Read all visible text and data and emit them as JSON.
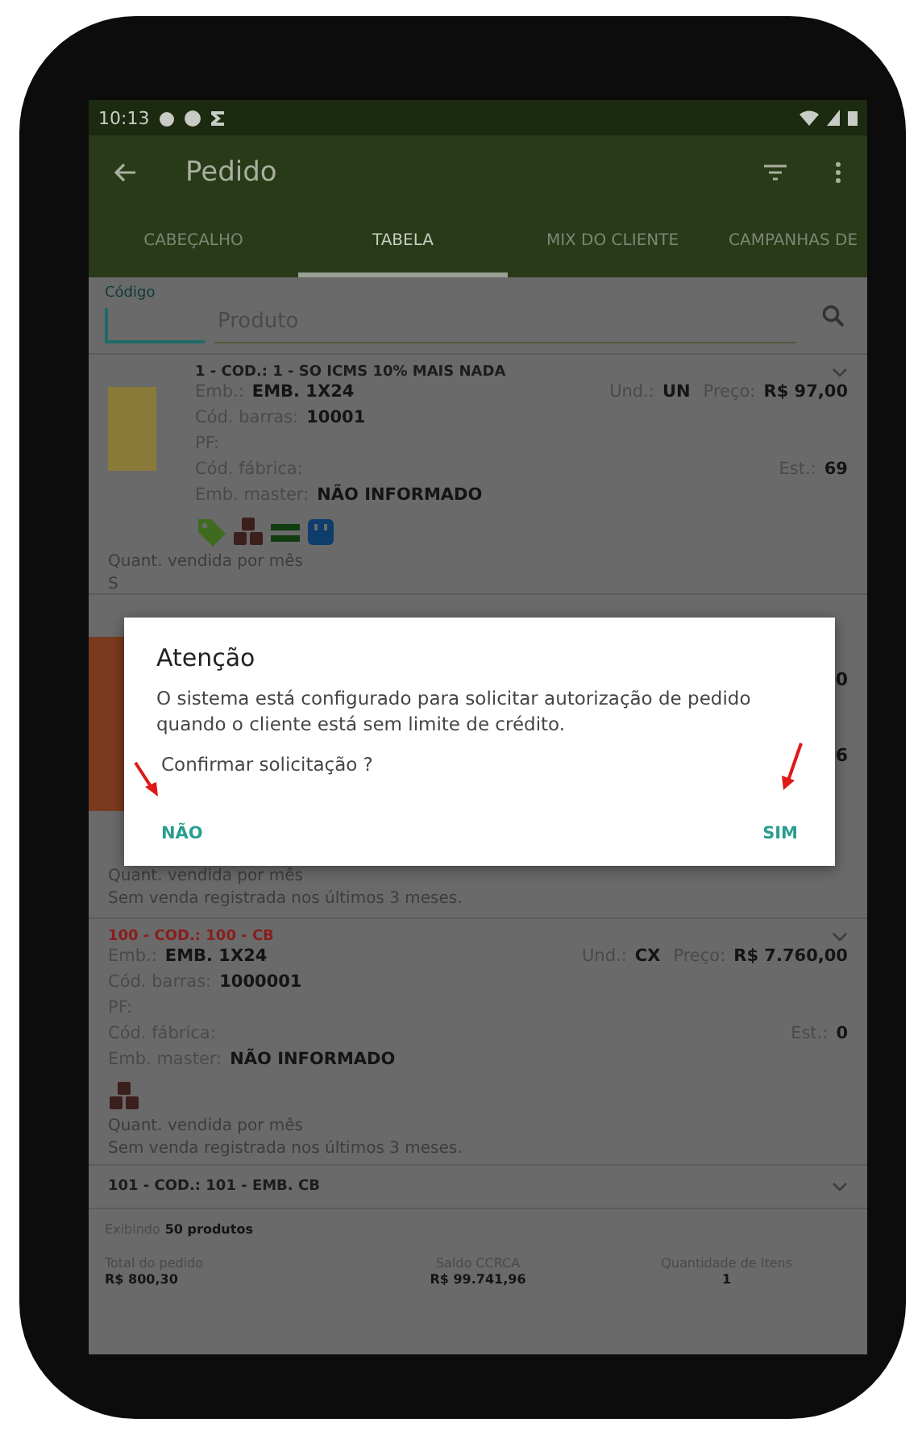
{
  "status_bar": {
    "time": "10:13"
  },
  "app_bar": {
    "title": "Pedido"
  },
  "tabs": [
    {
      "label": "CABEÇALHO",
      "selected": false
    },
    {
      "label": "TABELA",
      "selected": true
    },
    {
      "label": "MIX DO CLIENTE",
      "selected": false
    },
    {
      "label": "CAMPANHAS DE",
      "selected": false
    }
  ],
  "search": {
    "code_label": "Código",
    "product_placeholder": "Produto"
  },
  "products": [
    {
      "kind": "full",
      "title": "1 - COD.: 1 - SO ICMS 10% MAIS NADA",
      "alert": false,
      "has_photo": true,
      "rows": [
        {
          "label": "Emb.:",
          "value": "EMB. 1X24",
          "right": [
            {
              "label": "Und.:",
              "value": "UN"
            },
            {
              "label": "Preço:",
              "value": "R$ 97,00"
            }
          ]
        },
        {
          "label": "Cód. barras:",
          "value": "10001"
        },
        {
          "label": "PF:"
        },
        {
          "label": "Cód. fábrica:",
          "right": [
            {
              "label": "Est.:",
              "value": "69"
            }
          ]
        },
        {
          "label": "Emb. master:",
          "value": "NÃO INFORMADO"
        }
      ],
      "badges": [
        {
          "kind": "tag"
        },
        {
          "kind": "boxes"
        },
        {
          "kind": "equal"
        },
        {
          "kind": "pack"
        }
      ],
      "sales_label": "Quant. vendida por mês",
      "sales_note": "S"
    },
    {
      "kind": "covered",
      "has_photo": true,
      "fragments": [
        "0",
        "6"
      ],
      "sales_label": "Quant. vendida por mês",
      "sales_note": "Sem venda registrada nos últimos 3 meses."
    },
    {
      "kind": "full",
      "title": "100 - COD.: 100 - CB",
      "alert": true,
      "has_photo": false,
      "rows": [
        {
          "label": "Emb.:",
          "value": "EMB. 1X24",
          "right": [
            {
              "label": "Und.:",
              "value": "CX"
            },
            {
              "label": "Preço:",
              "value": "R$ 7.760,00"
            }
          ]
        },
        {
          "label": "Cód. barras:",
          "value": "1000001"
        },
        {
          "label": "PF:"
        },
        {
          "label": "Cód. fábrica:",
          "right": [
            {
              "label": "Est.:",
              "value": "0"
            }
          ]
        },
        {
          "label": "Emb. master:",
          "value": "NÃO INFORMADO"
        }
      ],
      "badges": [
        {
          "kind": "boxes"
        }
      ],
      "sales_label": "Quant. vendida por mês",
      "sales_note": "Sem venda registrada nos últimos 3 meses."
    },
    {
      "kind": "collapsed",
      "title": "101 - COD.: 101 - EMB. CB",
      "alert": false
    }
  ],
  "showing": {
    "prefix": "Exibindo",
    "count": "50 produtos"
  },
  "totals": [
    {
      "label": "Total do pedido",
      "value": "R$ 800,30"
    },
    {
      "label": "Saldo CCRCA",
      "value": "R$ 99.741,96"
    },
    {
      "label": "Quantidade de Itens",
      "value": "1"
    }
  ],
  "dialog": {
    "title": "Atenção",
    "message": "O sistema está configurado para solicitar autorização de pedido quando o cliente está sem limite de crédito.",
    "question": "Confirmar solicitação ?",
    "buttons": [
      "NÃO",
      "SIM"
    ]
  }
}
